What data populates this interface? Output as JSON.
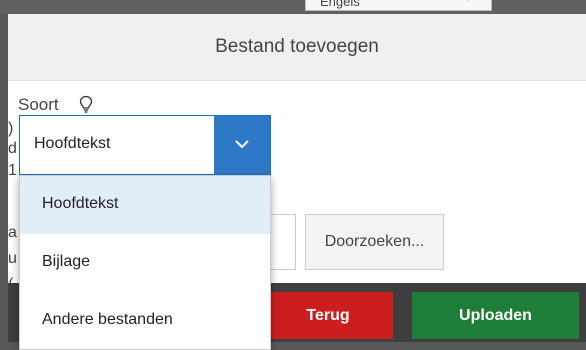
{
  "background": {
    "language_select": "Engels"
  },
  "modal": {
    "title": "Bestand toevoegen",
    "soort_label": "Soort",
    "select": {
      "value": "Hoofdtekst",
      "options": [
        "Hoofdtekst",
        "Bijlage",
        "Andere bestanden"
      ],
      "selected_index": 0
    },
    "browse_label": "Doorzoeken...",
    "footer": {
      "back_label": "Terug",
      "upload_label": "Uploaden"
    },
    "edge_fragments": [
      ")",
      "d",
      "1",
      "a",
      "u",
      "("
    ]
  },
  "colors": {
    "accent": "#2d79c7",
    "back": "#cc1e1e",
    "upload": "#1e7d36",
    "option_highlight": "#e1eef8"
  }
}
